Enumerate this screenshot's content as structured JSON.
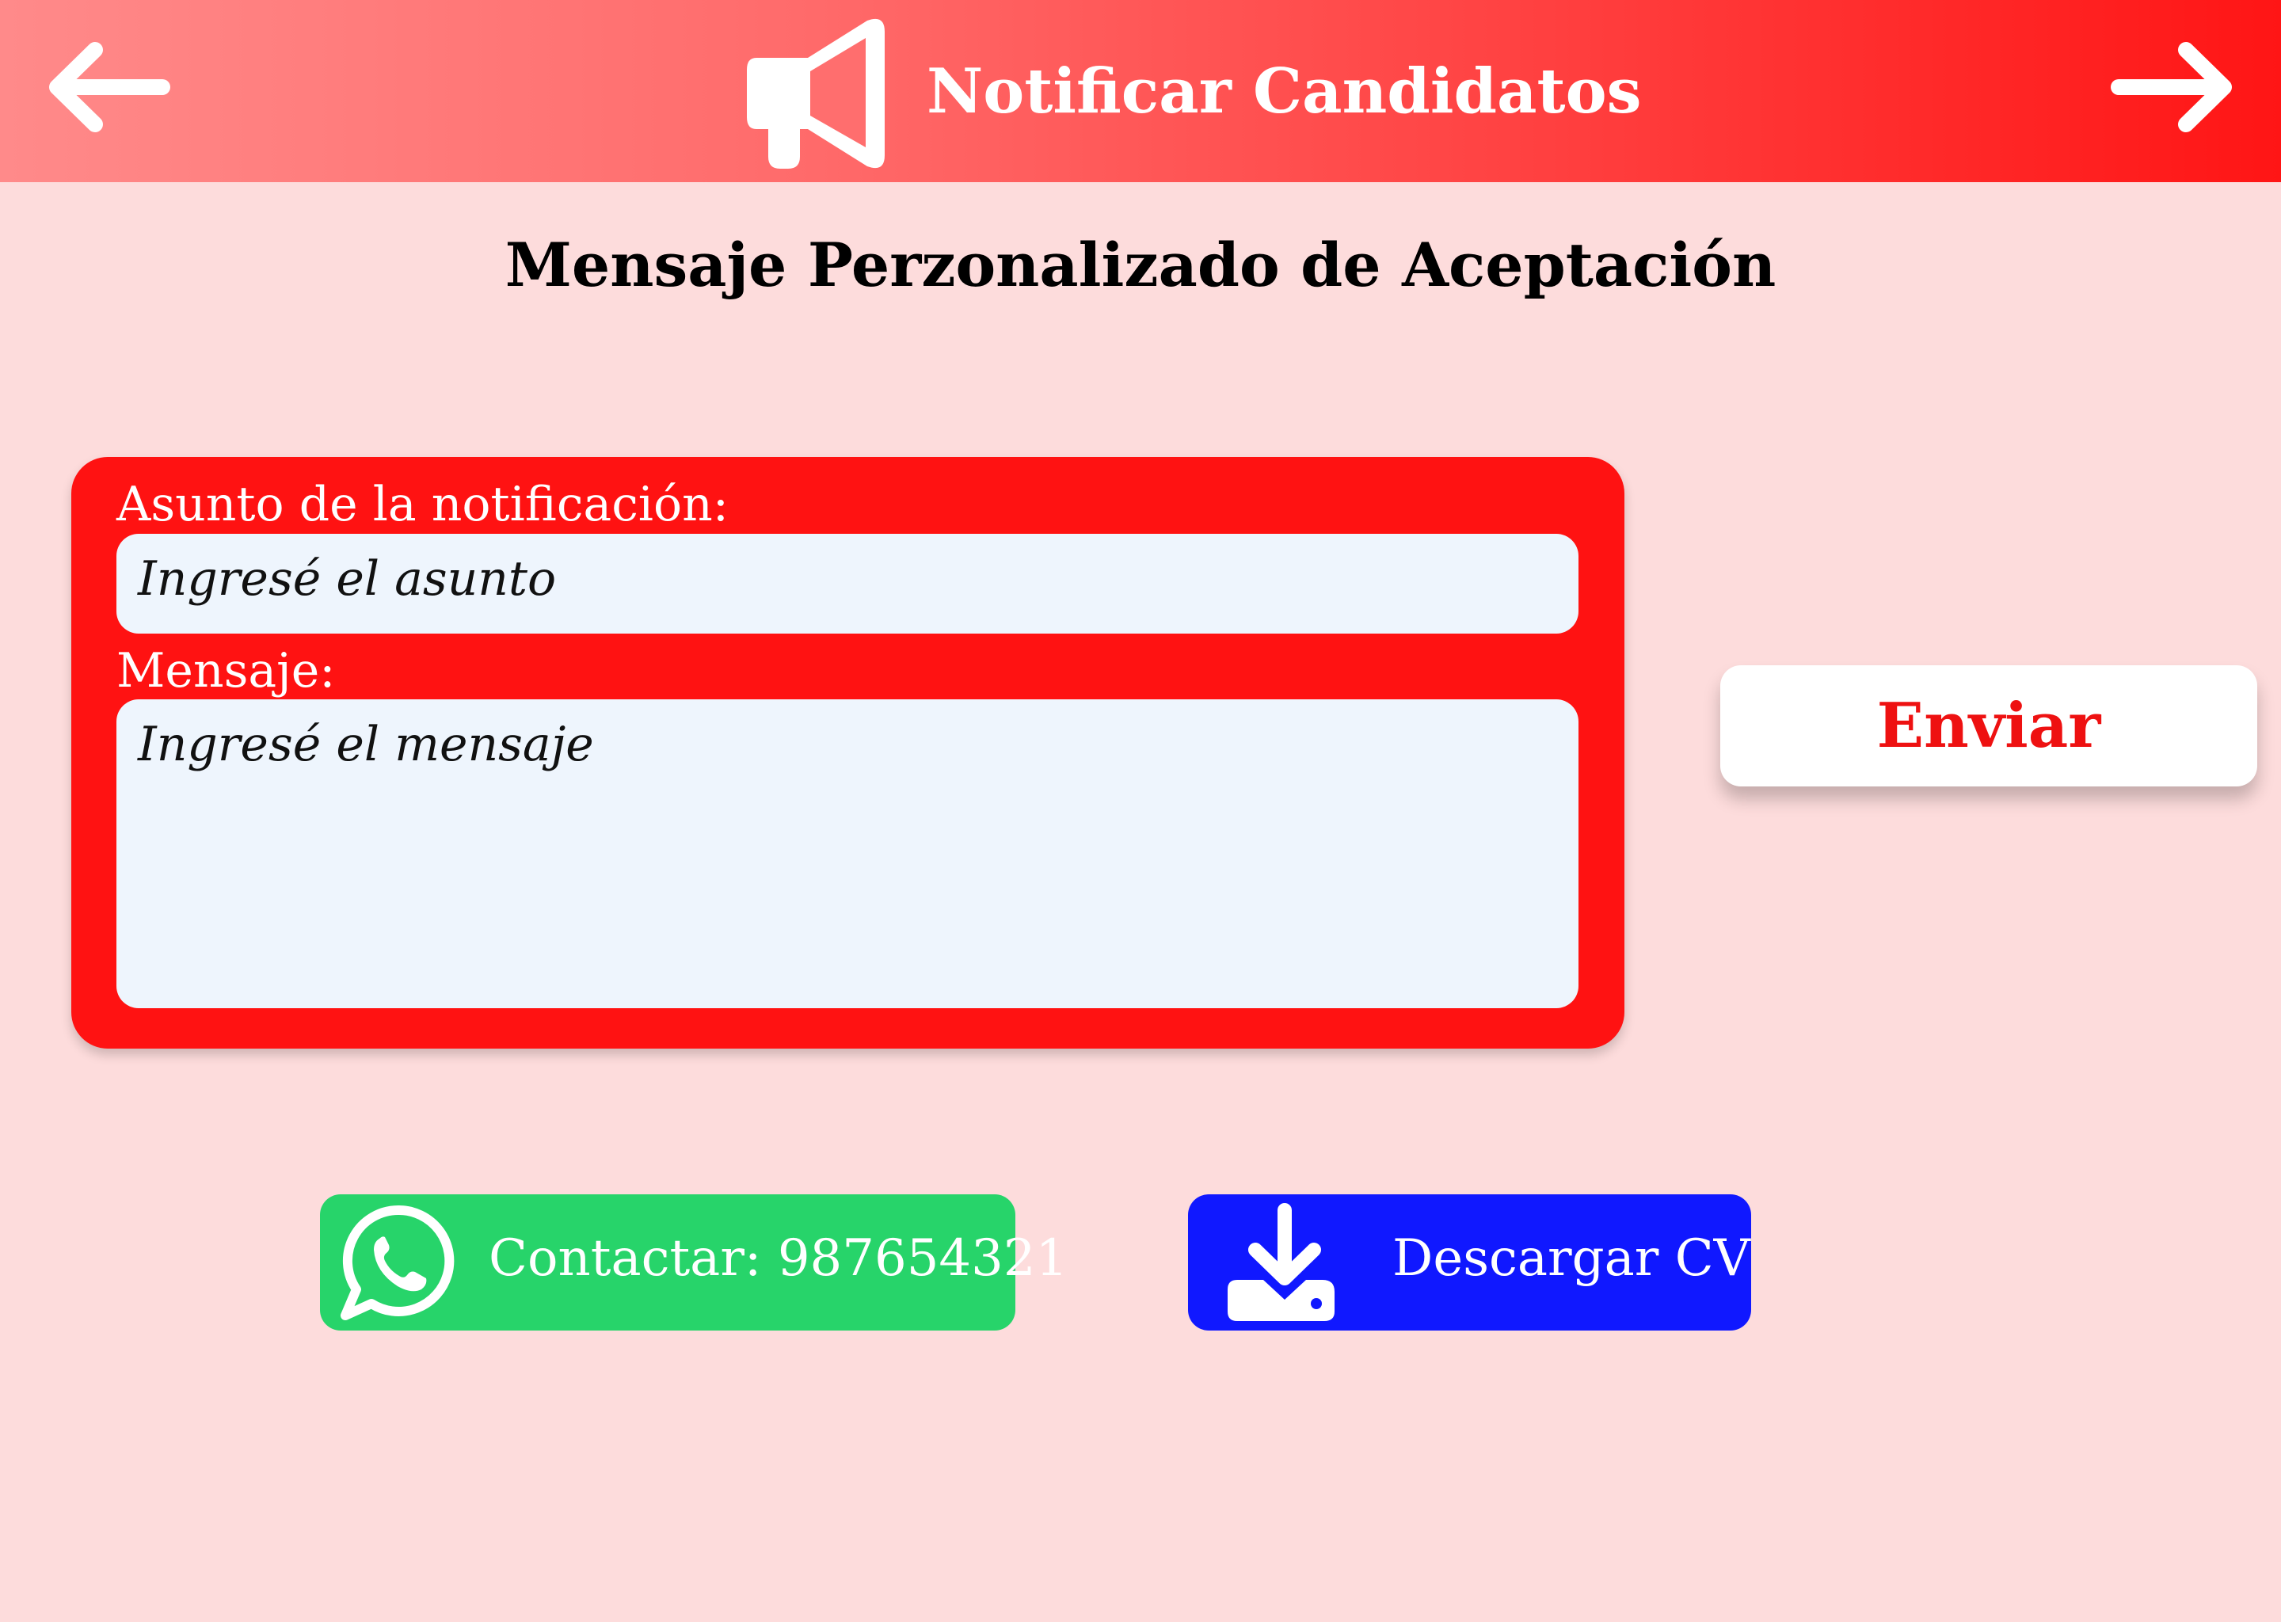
{
  "header": {
    "title": "Notificar Candidatos",
    "back_icon": "arrow-left-icon",
    "forward_icon": "arrow-right-icon",
    "title_icon": "megaphone-icon",
    "colors": {
      "gradient_start": "#ff8a8a",
      "gradient_end": "#ff1515"
    }
  },
  "page_title": "Mensaje Perzonalizado de Aceptación",
  "form": {
    "subject_label": "Asunto de la notificación:",
    "subject_placeholder": "Ingresé el asunto",
    "message_label": "Mensaje:",
    "message_placeholder": "Ingresé el mensaje",
    "card_color": "#ff1212"
  },
  "send_button": {
    "label": "Enviar",
    "color": "#ee1111"
  },
  "contact_button": {
    "label": "Contactar: 987654321",
    "icon": "whatsapp-icon",
    "color": "#27d46a"
  },
  "download_button": {
    "label": "Descargar CV",
    "icon": "download-icon",
    "color": "#1018ff"
  },
  "background_color": "#fddcdc"
}
